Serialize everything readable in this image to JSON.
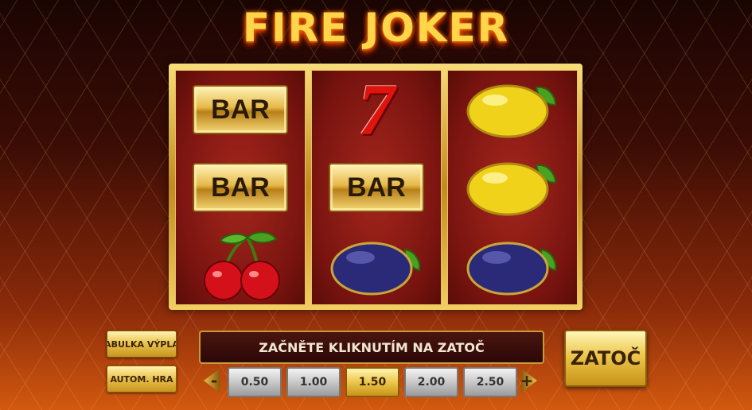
{
  "title": "FIRE JOKER",
  "reels": [
    [
      "BAR",
      "BAR",
      "cherry"
    ],
    [
      "7",
      "BAR",
      "plum"
    ],
    [
      "lemon",
      "lemon",
      "plum"
    ]
  ],
  "message": "ZAČNĚTE KLIKNUTÍM NA ZATOČ",
  "buttons": {
    "paytable": "TABULKA VÝPLAT",
    "autoplay": "AUTOM. HRA",
    "spin": "ZATOČ",
    "decrease": "-",
    "increase": "+"
  },
  "stakes": [
    "0.50",
    "1.00",
    "1.50",
    "2.00",
    "2.50"
  ],
  "selected_stake": "1.50",
  "colors": {
    "accent_gold": "#e8c04a",
    "reel_red": "#a5271d"
  }
}
